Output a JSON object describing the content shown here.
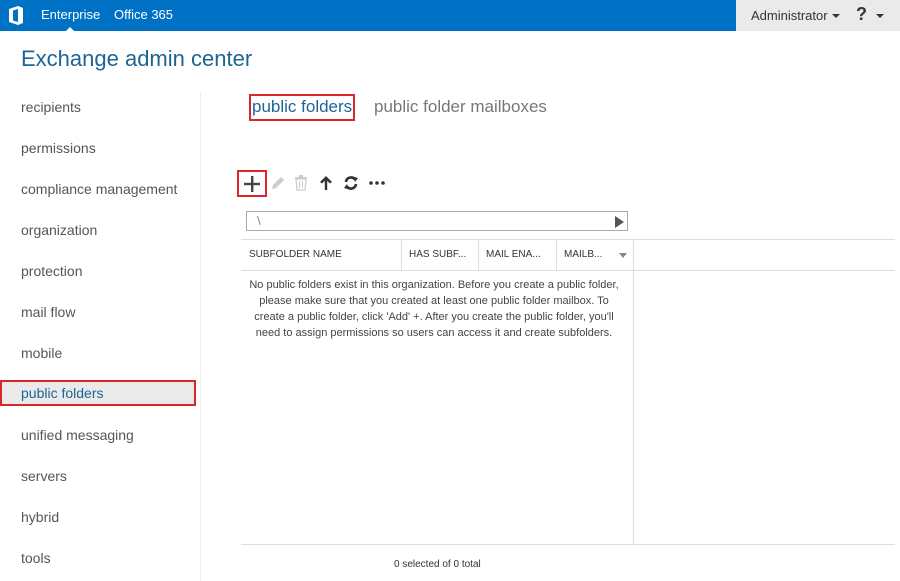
{
  "topbar": {
    "logo": "office-logo",
    "links": [
      {
        "label": "Enterprise",
        "active": true
      },
      {
        "label": "Office 365",
        "active": false
      }
    ],
    "user": "Administrator",
    "help": "?"
  },
  "app_title": "Exchange admin center",
  "sidebar": {
    "items": [
      {
        "label": "recipients"
      },
      {
        "label": "permissions"
      },
      {
        "label": "compliance management"
      },
      {
        "label": "organization"
      },
      {
        "label": "protection"
      },
      {
        "label": "mail flow"
      },
      {
        "label": "mobile"
      },
      {
        "label": "public folders",
        "selected": true
      },
      {
        "label": "unified messaging"
      },
      {
        "label": "servers"
      },
      {
        "label": "hybrid"
      },
      {
        "label": "tools"
      }
    ]
  },
  "tabs": [
    {
      "label": "public folders",
      "active": true
    },
    {
      "label": "public folder mailboxes",
      "active": false
    }
  ],
  "toolbar": {
    "icons": [
      "add-icon",
      "edit-icon",
      "delete-icon",
      "move-up-icon",
      "refresh-icon",
      "more-icon"
    ]
  },
  "path": {
    "value": "\\"
  },
  "grid": {
    "columns": [
      "SUBFOLDER NAME",
      "HAS SUBF...",
      "MAIL ENA...",
      "MAILB..."
    ],
    "empty_message": "No public folders exist in this organization. Before you create a public folder, please make sure that you created at least one public folder mailbox. To create a public folder, click 'Add' +. After you create the public folder, you'll need to assign permissions so users can access it and create subfolders."
  },
  "status": "0 selected of 0 total",
  "colors": {
    "brand": "#0072c6",
    "title": "#1e6495",
    "highlight": "#d9262c"
  }
}
